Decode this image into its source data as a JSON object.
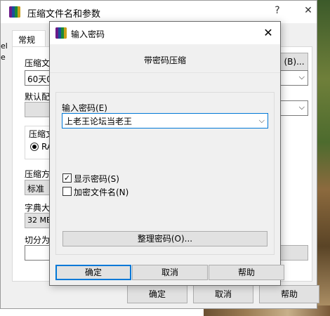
{
  "main_window": {
    "title": "压缩文件名和参数",
    "help_button": "?",
    "close_button": "✕",
    "tab_general": "常规",
    "left_edge_fragments": [
      "el",
      "e"
    ],
    "archive_name_label": "压缩文",
    "archive_name_value": "60天0",
    "browse_button": "(B)...",
    "default_profile_label": "默认配",
    "archive_format_label": "压缩文",
    "format_option": "RA",
    "compression_method_label": "压缩方",
    "compression_method_value": "标准",
    "dictionary_label": "字典大",
    "dictionary_value": "32 MB",
    "split_label": "切分为",
    "ok_button": "确定",
    "cancel_button": "取消",
    "help_button_label": "帮助"
  },
  "dialog": {
    "title": "输入密码",
    "close_button": "✕",
    "heading": "带密码压缩",
    "password_label": "输入密码(E)",
    "password_value": "上老王论坛当老王",
    "show_password_label": "显示密码(S)",
    "show_password_checked": true,
    "encrypt_filenames_label": "加密文件名(N)",
    "encrypt_filenames_checked": false,
    "organize_button": "整理密码(O)...",
    "ok_button": "确定",
    "cancel_button": "取消",
    "help_button": "帮助"
  },
  "icons": {
    "app": "winrar-books-icon",
    "dropdown": "chevron-down-icon",
    "checkmark": "checkmark-icon"
  },
  "colors": {
    "focus_blue": "#0078d7",
    "window_bg": "#f0f0f0",
    "button_bg": "#e1e1e1"
  }
}
